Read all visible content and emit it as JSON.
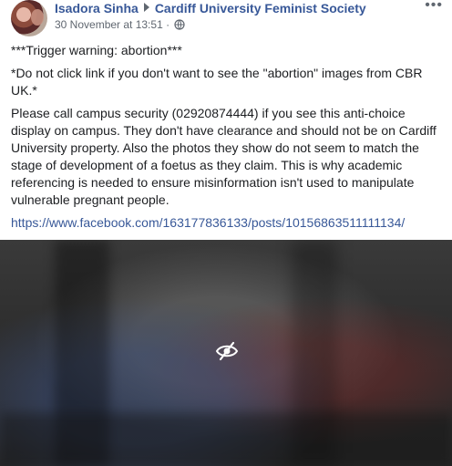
{
  "post": {
    "author": "Isadora Sinha",
    "group": "Cardiff University Feminist Society",
    "timestamp": "30 November at 13:51",
    "separator": "·",
    "more_label": "•••"
  },
  "body": {
    "warning": "***Trigger warning: abortion***",
    "note": "*Do not click link if you don't want to see the \"abortion\" images from CBR UK.*",
    "paragraph": "Please call campus security (02920874444) if you see this anti-choice display on campus. They don't have clearance and should not be on Cardiff University property. Also the photos they show do not seem to match the stage of development of a foetus as they claim. This is why academic referencing is needed to ensure misinformation isn't used to manipulate vulnerable pregnant people.",
    "link": "https://www.facebook.com/163177836133/posts/10156863511111134/"
  },
  "icons": {
    "privacy": "globe-icon",
    "media_overlay": "eye-slash-icon",
    "options": "more-icon"
  },
  "colors": {
    "link": "#385898",
    "text": "#1c1e21",
    "meta": "#606770"
  }
}
